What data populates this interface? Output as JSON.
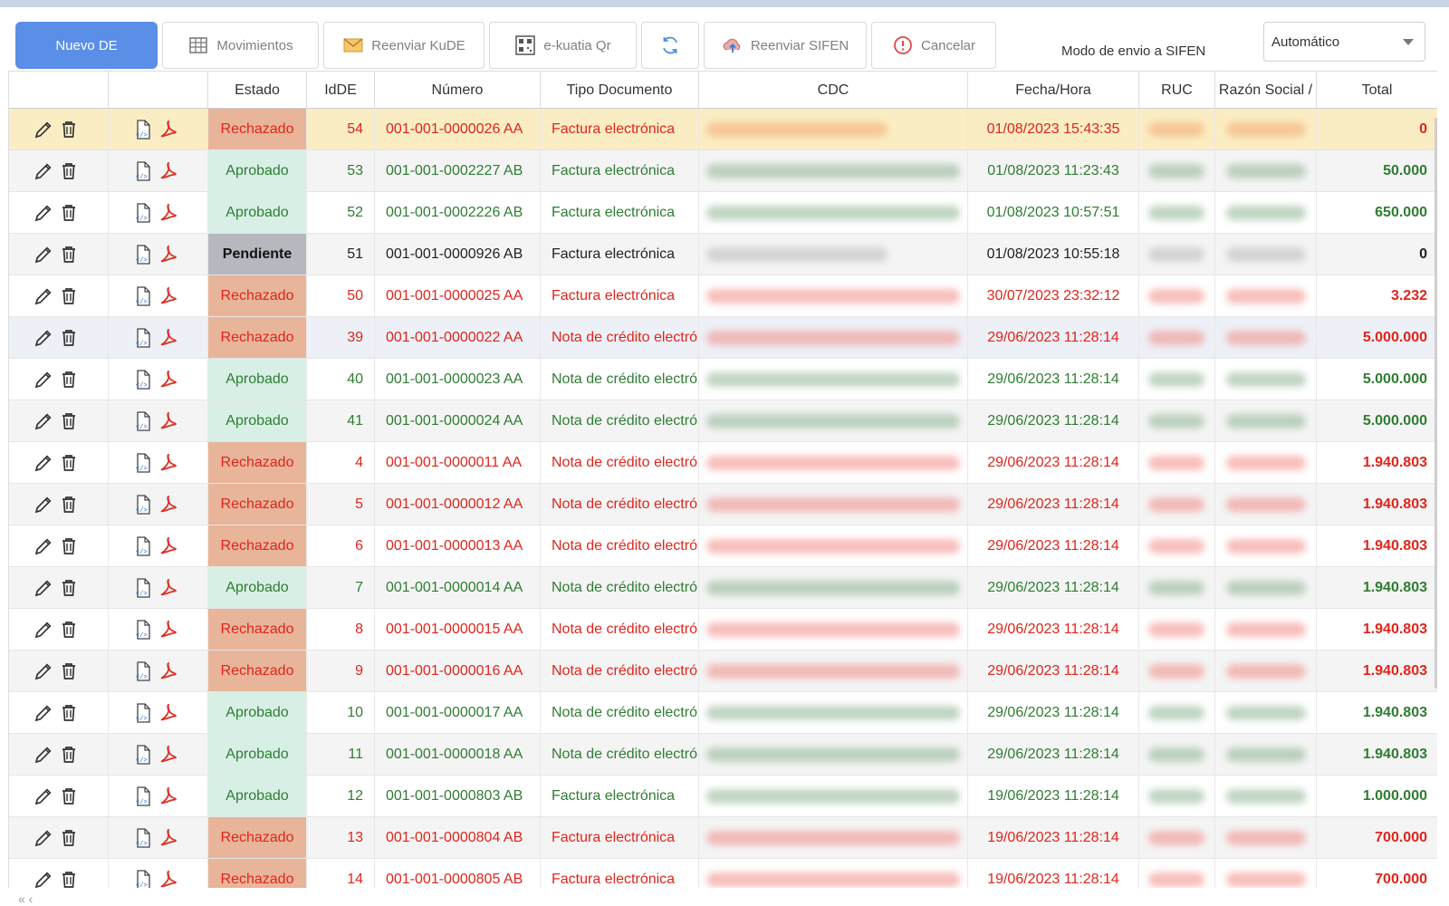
{
  "toolbar": {
    "nuevo": "Nuevo DE",
    "movimientos": "Movimientos",
    "reenviar_kude": "Reenviar KuDE",
    "ekuatia": "e-kuatia Qr",
    "reenviar_sifen": "Reenviar SIFEN",
    "cancelar": "Cancelar"
  },
  "mode": {
    "label": "Modo de envio a SIFEN",
    "value": "Automático"
  },
  "columns": {
    "estado": "Estado",
    "idde": "IdDE",
    "numero": "Número",
    "tipo": "Tipo Documento",
    "cdc": "CDC",
    "fecha": "Fecha/Hora",
    "ruc": "RUC",
    "razon": "Razón Social /",
    "total": "Total"
  },
  "rows": [
    {
      "estado": "Rechazado",
      "id": "54",
      "numero": "001-001-0000026 AA",
      "tipo": "Factura electrónica",
      "fecha": "01/08/2023 15:43:35",
      "total": "0"
    },
    {
      "estado": "Aprobado",
      "id": "53",
      "numero": "001-001-0002227 AB",
      "tipo": "Factura electrónica",
      "fecha": "01/08/2023 11:23:43",
      "total": "50.000"
    },
    {
      "estado": "Aprobado",
      "id": "52",
      "numero": "001-001-0002226 AB",
      "tipo": "Factura electrónica",
      "fecha": "01/08/2023 10:57:51",
      "total": "650.000"
    },
    {
      "estado": "Pendiente",
      "id": "51",
      "numero": "001-001-0000926 AB",
      "tipo": "Factura electrónica",
      "fecha": "01/08/2023 10:55:18",
      "total": "0"
    },
    {
      "estado": "Rechazado",
      "id": "50",
      "numero": "001-001-0000025 AA",
      "tipo": "Factura electrónica",
      "fecha": "30/07/2023 23:32:12",
      "total": "3.232"
    },
    {
      "estado": "Rechazado",
      "id": "39",
      "numero": "001-001-0000022 AA",
      "tipo": "Nota de crédito electró",
      "fecha": "29/06/2023 11:28:14",
      "total": "5.000.000"
    },
    {
      "estado": "Aprobado",
      "id": "40",
      "numero": "001-001-0000023 AA",
      "tipo": "Nota de crédito electró",
      "fecha": "29/06/2023 11:28:14",
      "total": "5.000.000"
    },
    {
      "estado": "Aprobado",
      "id": "41",
      "numero": "001-001-0000024 AA",
      "tipo": "Nota de crédito electró",
      "fecha": "29/06/2023 11:28:14",
      "total": "5.000.000"
    },
    {
      "estado": "Rechazado",
      "id": "4",
      "numero": "001-001-0000011 AA",
      "tipo": "Nota de crédito electró",
      "fecha": "29/06/2023 11:28:14",
      "total": "1.940.803"
    },
    {
      "estado": "Rechazado",
      "id": "5",
      "numero": "001-001-0000012 AA",
      "tipo": "Nota de crédito electró",
      "fecha": "29/06/2023 11:28:14",
      "total": "1.940.803"
    },
    {
      "estado": "Rechazado",
      "id": "6",
      "numero": "001-001-0000013 AA",
      "tipo": "Nota de crédito electró",
      "fecha": "29/06/2023 11:28:14",
      "total": "1.940.803"
    },
    {
      "estado": "Aprobado",
      "id": "7",
      "numero": "001-001-0000014 AA",
      "tipo": "Nota de crédito electró",
      "fecha": "29/06/2023 11:28:14",
      "total": "1.940.803"
    },
    {
      "estado": "Rechazado",
      "id": "8",
      "numero": "001-001-0000015 AA",
      "tipo": "Nota de crédito electró",
      "fecha": "29/06/2023 11:28:14",
      "total": "1.940.803"
    },
    {
      "estado": "Rechazado",
      "id": "9",
      "numero": "001-001-0000016 AA",
      "tipo": "Nota de crédito electró",
      "fecha": "29/06/2023 11:28:14",
      "total": "1.940.803"
    },
    {
      "estado": "Aprobado",
      "id": "10",
      "numero": "001-001-0000017 AA",
      "tipo": "Nota de crédito electró",
      "fecha": "29/06/2023 11:28:14",
      "total": "1.940.803"
    },
    {
      "estado": "Aprobado",
      "id": "11",
      "numero": "001-001-0000018 AA",
      "tipo": "Nota de crédito electró",
      "fecha": "29/06/2023 11:28:14",
      "total": "1.940.803"
    },
    {
      "estado": "Aprobado",
      "id": "12",
      "numero": "001-001-0000803 AB",
      "tipo": "Factura electrónica",
      "fecha": "19/06/2023 11:28:14",
      "total": "1.000.000"
    },
    {
      "estado": "Rechazado",
      "id": "13",
      "numero": "001-001-0000804 AB",
      "tipo": "Factura electrónica",
      "fecha": "19/06/2023 11:28:14",
      "total": "700.000"
    },
    {
      "estado": "Rechazado",
      "id": "14",
      "numero": "001-001-0000805 AB",
      "tipo": "Factura electrónica",
      "fecha": "19/06/2023 11:28:14",
      "total": "700.000"
    }
  ],
  "colors": {
    "primary": "#5b8ee6",
    "rechazado_text": "#e0251b",
    "rechazado_bg": "#e8b59a",
    "aprobado_text": "#2e7d32",
    "aprobado_bg": "#d8efe6",
    "pendiente_bg": "#b5b8bf",
    "selected_row": "#fbedc3"
  }
}
